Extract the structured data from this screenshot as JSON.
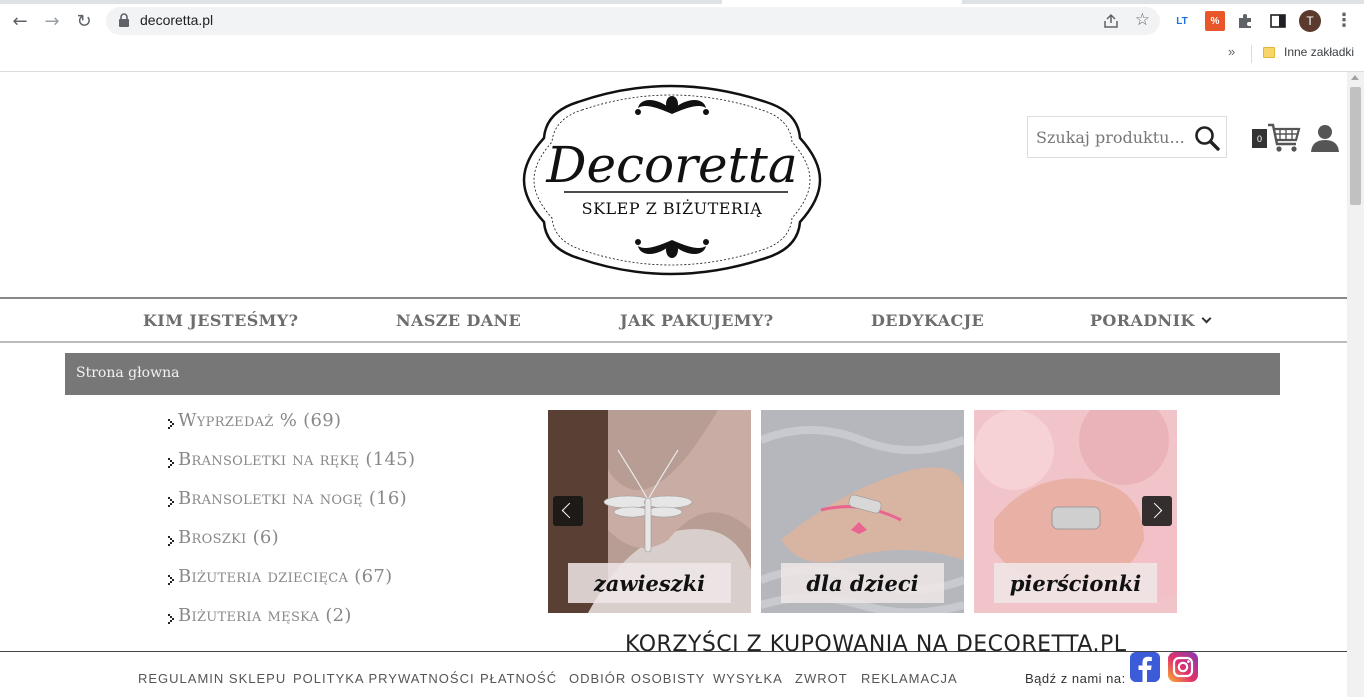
{
  "browser": {
    "url": "decoretta.pl",
    "bookmarks_folder": "Inne zakładki",
    "bookmarks_more": "»",
    "profile_initial": "T",
    "ext1": "LT",
    "ext2": "%"
  },
  "header": {
    "logo_title": "Decoretta",
    "logo_subtitle": "SKLEP Z BIŻUTERIĄ",
    "search_placeholder": "Szukaj produktu...",
    "cart_count": "0"
  },
  "menu": {
    "items": [
      "KIM JESTEŚMY?",
      "NASZE DANE",
      "JAK PAKUJEMY?",
      "DEDYKACJE",
      "PORADNIK"
    ]
  },
  "breadcrumb": "Strona głowna",
  "categories": [
    "Wyprzedaż % (69)",
    "Bransoletki na rękę (145)",
    "Bransoletki na nogę (16)",
    "Broszki (6)",
    "Biżuteria dziecięca (67)",
    "Biżuteria męska (2)"
  ],
  "tiles": [
    "zawieszki",
    "dla dzieci",
    "pierścionki"
  ],
  "benefits_heading": "KORZYŚCI Z KUPOWANIA NA DECORETTA.PL",
  "footer": {
    "links": [
      "REGULAMIN SKLEPU",
      "POLITYKA PRYWATNOŚCI",
      "PŁATNOŚĆ",
      "ODBIÓR OSOBISTY",
      "WYSYŁKA",
      "ZWROT",
      "REKLAMACJA"
    ],
    "follow_label": "Bądź z nami na:"
  },
  "colors": {
    "menu_text": "#6d6d6d",
    "breadcrumb_bg": "#777777",
    "category_text": "#888888",
    "facebook": "#3b5bd8"
  }
}
